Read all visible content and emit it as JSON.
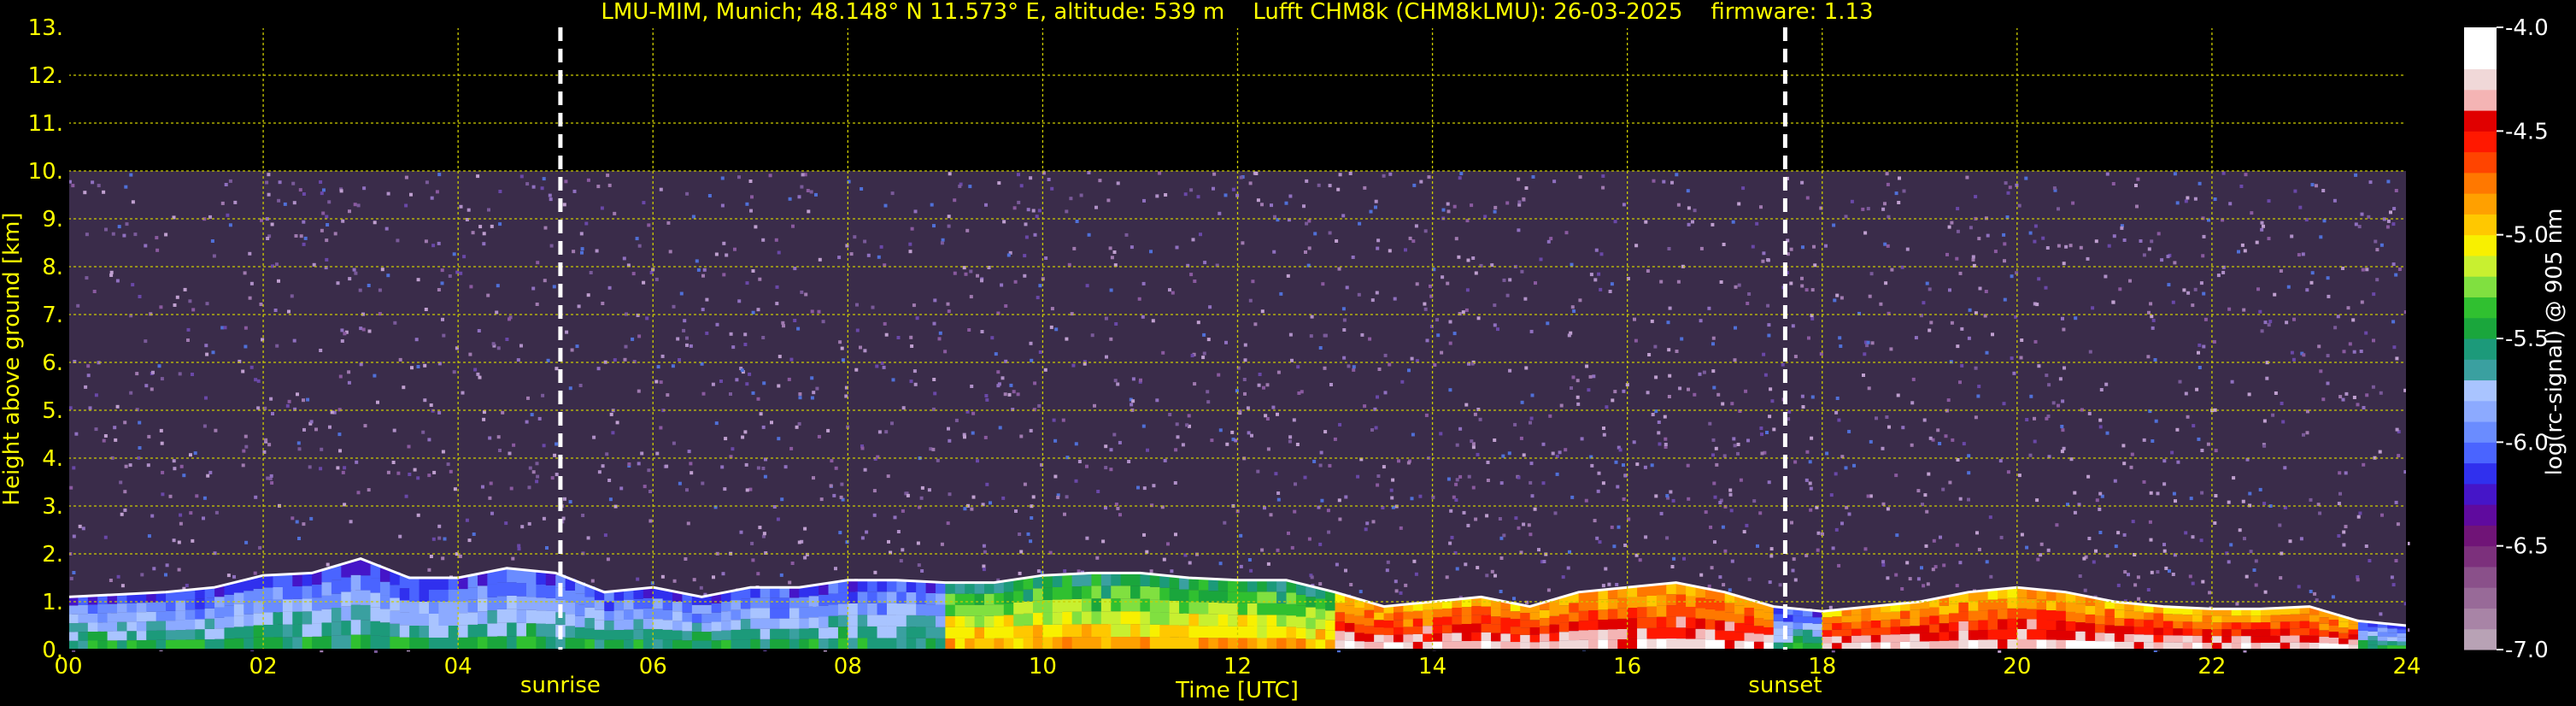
{
  "title": "LMU-MIM, Munich; 48.148° N 11.573° E, altitude: 539 m    Lufft CHM8k (CHM8kLMU): 26-03-2025    firmware: 1.13",
  "colors": {
    "text": "#ffff00",
    "grid": "#cccc00",
    "background": "#000000",
    "marker": "#ffffff",
    "colorbar_text": "#ffffff"
  },
  "chart_data": {
    "type": "heatmap",
    "xlabel": "Time [UTC]",
    "ylabel": "Height above ground [km]",
    "xlim": [
      0,
      24
    ],
    "ylim": [
      0,
      13
    ],
    "x_ticks": [
      "00",
      "02",
      "04",
      "06",
      "08",
      "10",
      "12",
      "14",
      "16",
      "18",
      "20",
      "22",
      "24"
    ],
    "y_ticks": [
      "0.",
      "1.",
      "2.",
      "3.",
      "4.",
      "5.",
      "6.",
      "7.",
      "8.",
      "9.",
      "10.",
      "11.",
      "12.",
      "13."
    ],
    "grid": true,
    "data_top_km": 10.0,
    "markers": [
      {
        "label": "sunrise",
        "time_hours": 5.05
      },
      {
        "label": "sunset",
        "time_hours": 17.62
      }
    ],
    "colorbar": {
      "label": "log(rc-signal) @ 905 nm",
      "range": [
        -7.0,
        -4.0
      ],
      "ticks": [
        "-4.0",
        "-4.5",
        "-5.0",
        "-5.5",
        "-6.0",
        "-6.5",
        "-7.0"
      ],
      "colors": [
        "#b8a2b5",
        "#a884a6",
        "#986a98",
        "#8a508a",
        "#7c307c",
        "#701477",
        "#5f0a9e",
        "#4515c8",
        "#3030ee",
        "#4a64ff",
        "#6a8cff",
        "#8caaff",
        "#a9c4ff",
        "#3aa0a0",
        "#1c9a7a",
        "#1aa63c",
        "#30c030",
        "#80e040",
        "#c8f030",
        "#f8f000",
        "#ffc800",
        "#ffa000",
        "#ff7800",
        "#ff4400",
        "#ff1800",
        "#e00000",
        "#f4b4b4",
        "#f0d8d8",
        "#ffffff",
        "#ffffff"
      ]
    },
    "boundary_layer_km": [
      {
        "t": 0.0,
        "h": 1.1
      },
      {
        "t": 0.5,
        "h": 1.15
      },
      {
        "t": 1.0,
        "h": 1.2
      },
      {
        "t": 1.5,
        "h": 1.3
      },
      {
        "t": 2.0,
        "h": 1.55
      },
      {
        "t": 2.5,
        "h": 1.6
      },
      {
        "t": 3.0,
        "h": 1.9
      },
      {
        "t": 3.5,
        "h": 1.5
      },
      {
        "t": 4.0,
        "h": 1.5
      },
      {
        "t": 4.5,
        "h": 1.7
      },
      {
        "t": 5.0,
        "h": 1.6
      },
      {
        "t": 5.5,
        "h": 1.2
      },
      {
        "t": 6.0,
        "h": 1.3
      },
      {
        "t": 6.5,
        "h": 1.1
      },
      {
        "t": 7.0,
        "h": 1.3
      },
      {
        "t": 7.5,
        "h": 1.3
      },
      {
        "t": 8.0,
        "h": 1.45
      },
      {
        "t": 8.5,
        "h": 1.45
      },
      {
        "t": 9.0,
        "h": 1.4
      },
      {
        "t": 9.5,
        "h": 1.4
      },
      {
        "t": 10.0,
        "h": 1.55
      },
      {
        "t": 10.5,
        "h": 1.6
      },
      {
        "t": 11.0,
        "h": 1.6
      },
      {
        "t": 11.5,
        "h": 1.5
      },
      {
        "t": 12.0,
        "h": 1.45
      },
      {
        "t": 12.5,
        "h": 1.45
      },
      {
        "t": 13.0,
        "h": 1.2
      },
      {
        "t": 13.5,
        "h": 0.9
      },
      {
        "t": 14.0,
        "h": 1.0
      },
      {
        "t": 14.5,
        "h": 1.1
      },
      {
        "t": 15.0,
        "h": 0.9
      },
      {
        "t": 15.5,
        "h": 1.2
      },
      {
        "t": 16.0,
        "h": 1.3
      },
      {
        "t": 16.5,
        "h": 1.4
      },
      {
        "t": 17.0,
        "h": 1.2
      },
      {
        "t": 17.5,
        "h": 0.9
      },
      {
        "t": 18.0,
        "h": 0.8
      },
      {
        "t": 18.5,
        "h": 0.9
      },
      {
        "t": 19.0,
        "h": 1.0
      },
      {
        "t": 19.5,
        "h": 1.2
      },
      {
        "t": 20.0,
        "h": 1.3
      },
      {
        "t": 20.5,
        "h": 1.2
      },
      {
        "t": 21.0,
        "h": 1.0
      },
      {
        "t": 21.5,
        "h": 0.9
      },
      {
        "t": 22.0,
        "h": 0.85
      },
      {
        "t": 22.5,
        "h": 0.85
      },
      {
        "t": 23.0,
        "h": 0.9
      },
      {
        "t": 23.5,
        "h": 0.6
      },
      {
        "t": 24.0,
        "h": 0.5
      }
    ]
  }
}
